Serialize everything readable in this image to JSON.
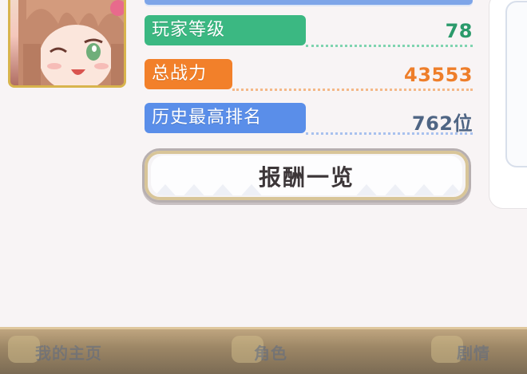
{
  "stats": [
    {
      "label": "玩家等级",
      "value": "78",
      "pill_color": "#3bb882",
      "value_color": "#2b9a6b",
      "dot_color": "#7fd4b0"
    },
    {
      "label": "总战力",
      "value": "43553",
      "pill_color": "#f2802a",
      "value_color": "#ee7e2a",
      "dot_color": "#f4b887"
    },
    {
      "label": "历史最高排名",
      "value": "762位",
      "pill_color": "#5a8ee9",
      "value_color": "#4f6584",
      "dot_color": "#a8c1ee"
    }
  ],
  "reward_button": {
    "label": "报酬一览"
  },
  "nav": {
    "items": [
      {
        "label": "我的主页"
      },
      {
        "label": "角色"
      },
      {
        "label": "剧情"
      }
    ]
  }
}
